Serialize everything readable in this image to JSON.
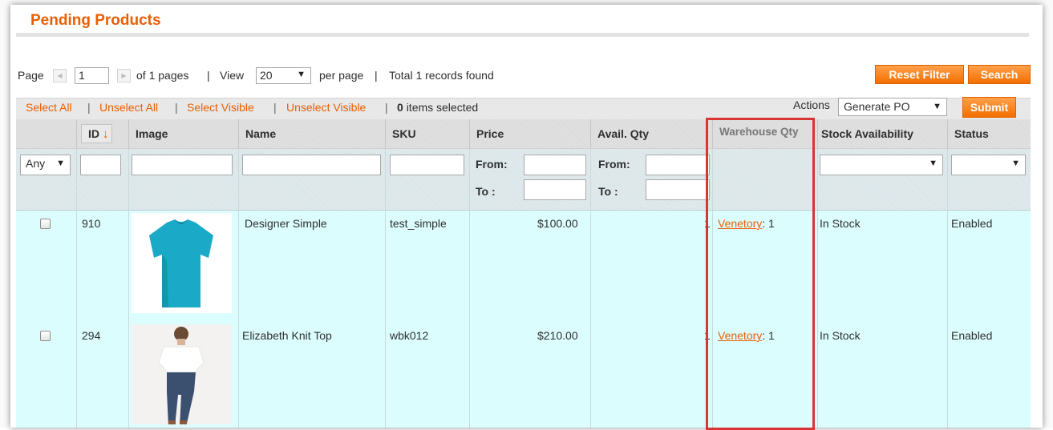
{
  "page": {
    "title": "Pending Products"
  },
  "pager": {
    "page_label": "Page",
    "page_value": "1",
    "of_pages": "of 1 pages",
    "sep1": "|",
    "view_label": "View",
    "per_page_value": "20",
    "per_page_label": "per page",
    "sep2": "|",
    "total": "Total 1 records found"
  },
  "buttons": {
    "reset_filter": "Reset Filter",
    "search": "Search",
    "submit": "Submit"
  },
  "massaction": {
    "select_all": "Select All",
    "unselect_all": "Unselect All",
    "select_visible": "Select Visible",
    "unselect_visible": "Unselect Visible",
    "sep": "|",
    "selected_count": "0",
    "selected_suffix": "items selected",
    "actions_label": "Actions",
    "action_value": "Generate PO"
  },
  "columns": {
    "id": "ID",
    "id_sort_icon": "sort-down-arrow-icon",
    "image": "Image",
    "name": "Name",
    "sku": "SKU",
    "price": "Price",
    "avail_qty": "Avail. Qty",
    "warehouse_qty": "Warehouse Qty",
    "stock_availability": "Stock Availability",
    "status": "Status"
  },
  "filters": {
    "any": "Any",
    "from": "From:",
    "to": "To :"
  },
  "rows": [
    {
      "id": "910",
      "image": "turquoise-tshirt-image",
      "name": "Designer Simple",
      "sku": "test_simple",
      "price": "$100.00",
      "avail_qty": "1",
      "warehouse_name": "Venetory",
      "warehouse_qty": ": 1",
      "stock": "In Stock",
      "status": "Enabled"
    },
    {
      "id": "294",
      "image": "woman-white-knit-top-image",
      "name": "Elizabeth Knit Top",
      "sku": "wbk012",
      "price": "$210.00",
      "avail_qty": "1",
      "warehouse_name": "Venetory",
      "warehouse_qty": ": 1",
      "stock": "In Stock",
      "status": "Enabled"
    }
  ],
  "colors": {
    "accent": "#eb5e00",
    "row_bg": "#dcfdfe",
    "highlight": "#d93535"
  }
}
